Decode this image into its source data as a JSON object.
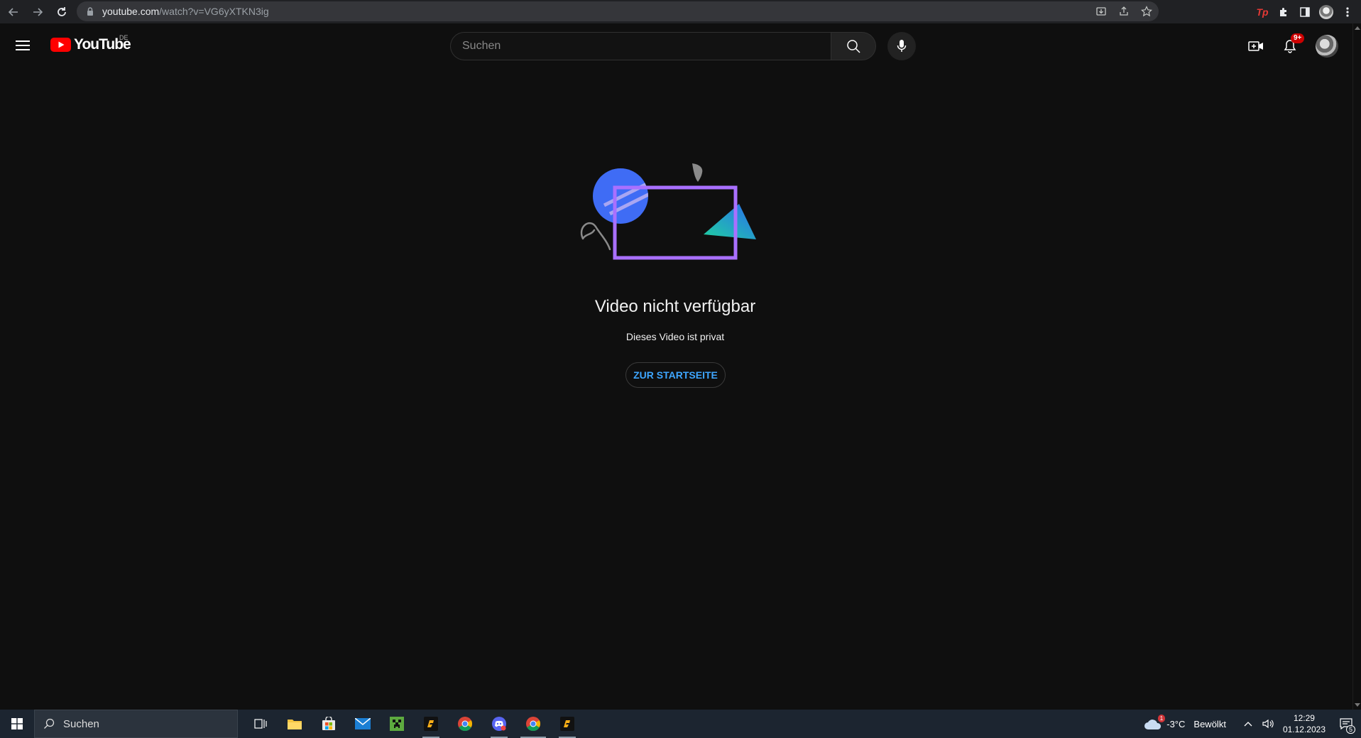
{
  "browser": {
    "url_host": "youtube.com",
    "url_path": "/watch?v=VG6yXTKN3ig",
    "extension_label": "Tp"
  },
  "header": {
    "logo_text": "YouTube",
    "region": "DE",
    "search_placeholder": "Suchen",
    "notification_count": "9+"
  },
  "main": {
    "title": "Video nicht verfügbar",
    "subtitle": "Dieses Video ist privat",
    "home_button": "ZUR STARTSEITE"
  },
  "taskbar": {
    "search_label": "Suchen",
    "weather_temp": "-3°C",
    "weather_text": "Bewölkt",
    "time": "12:29",
    "date": "01.12.2023",
    "notification_count": "5",
    "weather_badge": "1"
  },
  "colors": {
    "accent_link": "#3ea6ff",
    "yt_red": "#ff0000",
    "illus_purple": "#a970ff",
    "illus_blue": "#3f6cf5",
    "illus_teal": "#1fbf9c"
  }
}
